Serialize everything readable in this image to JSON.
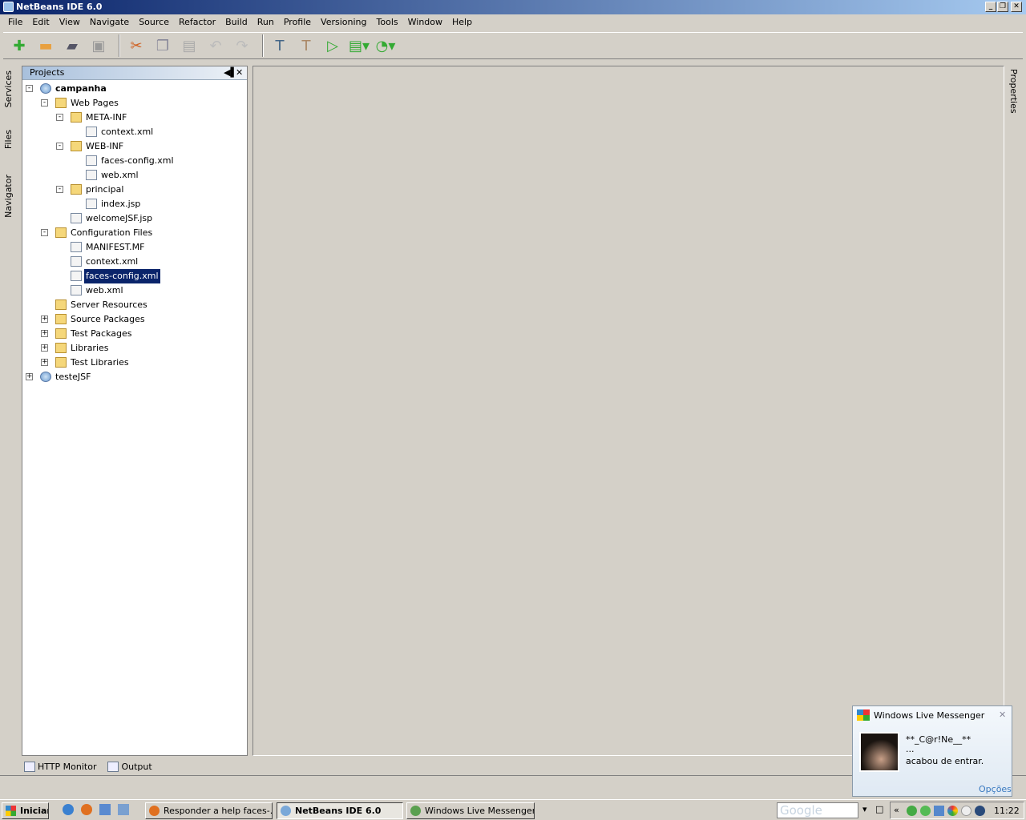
{
  "window": {
    "title": "NetBeans IDE 6.0"
  },
  "menu": [
    "File",
    "Edit",
    "View",
    "Navigate",
    "Source",
    "Refactor",
    "Build",
    "Run",
    "Profile",
    "Versioning",
    "Tools",
    "Window",
    "Help"
  ],
  "side_tabs": {
    "left": [
      "Services",
      "Files",
      "Navigator"
    ],
    "right": [
      "Properties"
    ]
  },
  "projects": {
    "title": "Projects",
    "tree": [
      {
        "label": "campanha",
        "level": 0,
        "icon": "project",
        "expander": "-",
        "bold": true
      },
      {
        "label": "Web Pages",
        "level": 1,
        "icon": "folder",
        "expander": "-"
      },
      {
        "label": "META-INF",
        "level": 2,
        "icon": "folder",
        "expander": "-"
      },
      {
        "label": "context.xml",
        "level": 3,
        "icon": "file"
      },
      {
        "label": "WEB-INF",
        "level": 2,
        "icon": "folder",
        "expander": "-"
      },
      {
        "label": "faces-config.xml",
        "level": 3,
        "icon": "file"
      },
      {
        "label": "web.xml",
        "level": 3,
        "icon": "file"
      },
      {
        "label": "principal",
        "level": 2,
        "icon": "folder",
        "expander": "-"
      },
      {
        "label": "index.jsp",
        "level": 3,
        "icon": "file"
      },
      {
        "label": "welcomeJSF.jsp",
        "level": 2,
        "icon": "file"
      },
      {
        "label": "Configuration Files",
        "level": 1,
        "icon": "folder",
        "expander": "-"
      },
      {
        "label": "MANIFEST.MF",
        "level": 2,
        "icon": "file"
      },
      {
        "label": "context.xml",
        "level": 2,
        "icon": "file"
      },
      {
        "label": "faces-config.xml",
        "level": 2,
        "icon": "file",
        "selected": true
      },
      {
        "label": "web.xml",
        "level": 2,
        "icon": "file"
      },
      {
        "label": "Server Resources",
        "level": 1,
        "icon": "folder"
      },
      {
        "label": "Source Packages",
        "level": 1,
        "icon": "folder",
        "expander": "+"
      },
      {
        "label": "Test Packages",
        "level": 1,
        "icon": "folder",
        "expander": "+"
      },
      {
        "label": "Libraries",
        "level": 1,
        "icon": "folder",
        "expander": "+"
      },
      {
        "label": "Test Libraries",
        "level": 1,
        "icon": "folder",
        "expander": "+"
      },
      {
        "label": "testeJSF",
        "level": 0,
        "icon": "project",
        "expander": "+"
      }
    ]
  },
  "bottom_tabs": [
    "HTTP Monitor",
    "Output"
  ],
  "taskbar": {
    "start": "Iniciar",
    "tasks": [
      "Responder a help faces-...",
      "NetBeans IDE 6.0",
      "Windows Live Messenger"
    ],
    "search_placeholder": "Google",
    "clock": "11:22"
  },
  "messenger_popup": {
    "title": "Windows Live Messenger",
    "name": "**_C@r!Ne__**",
    "ellipsis": "...",
    "message": "acabou de entrar.",
    "options": "Opções"
  }
}
